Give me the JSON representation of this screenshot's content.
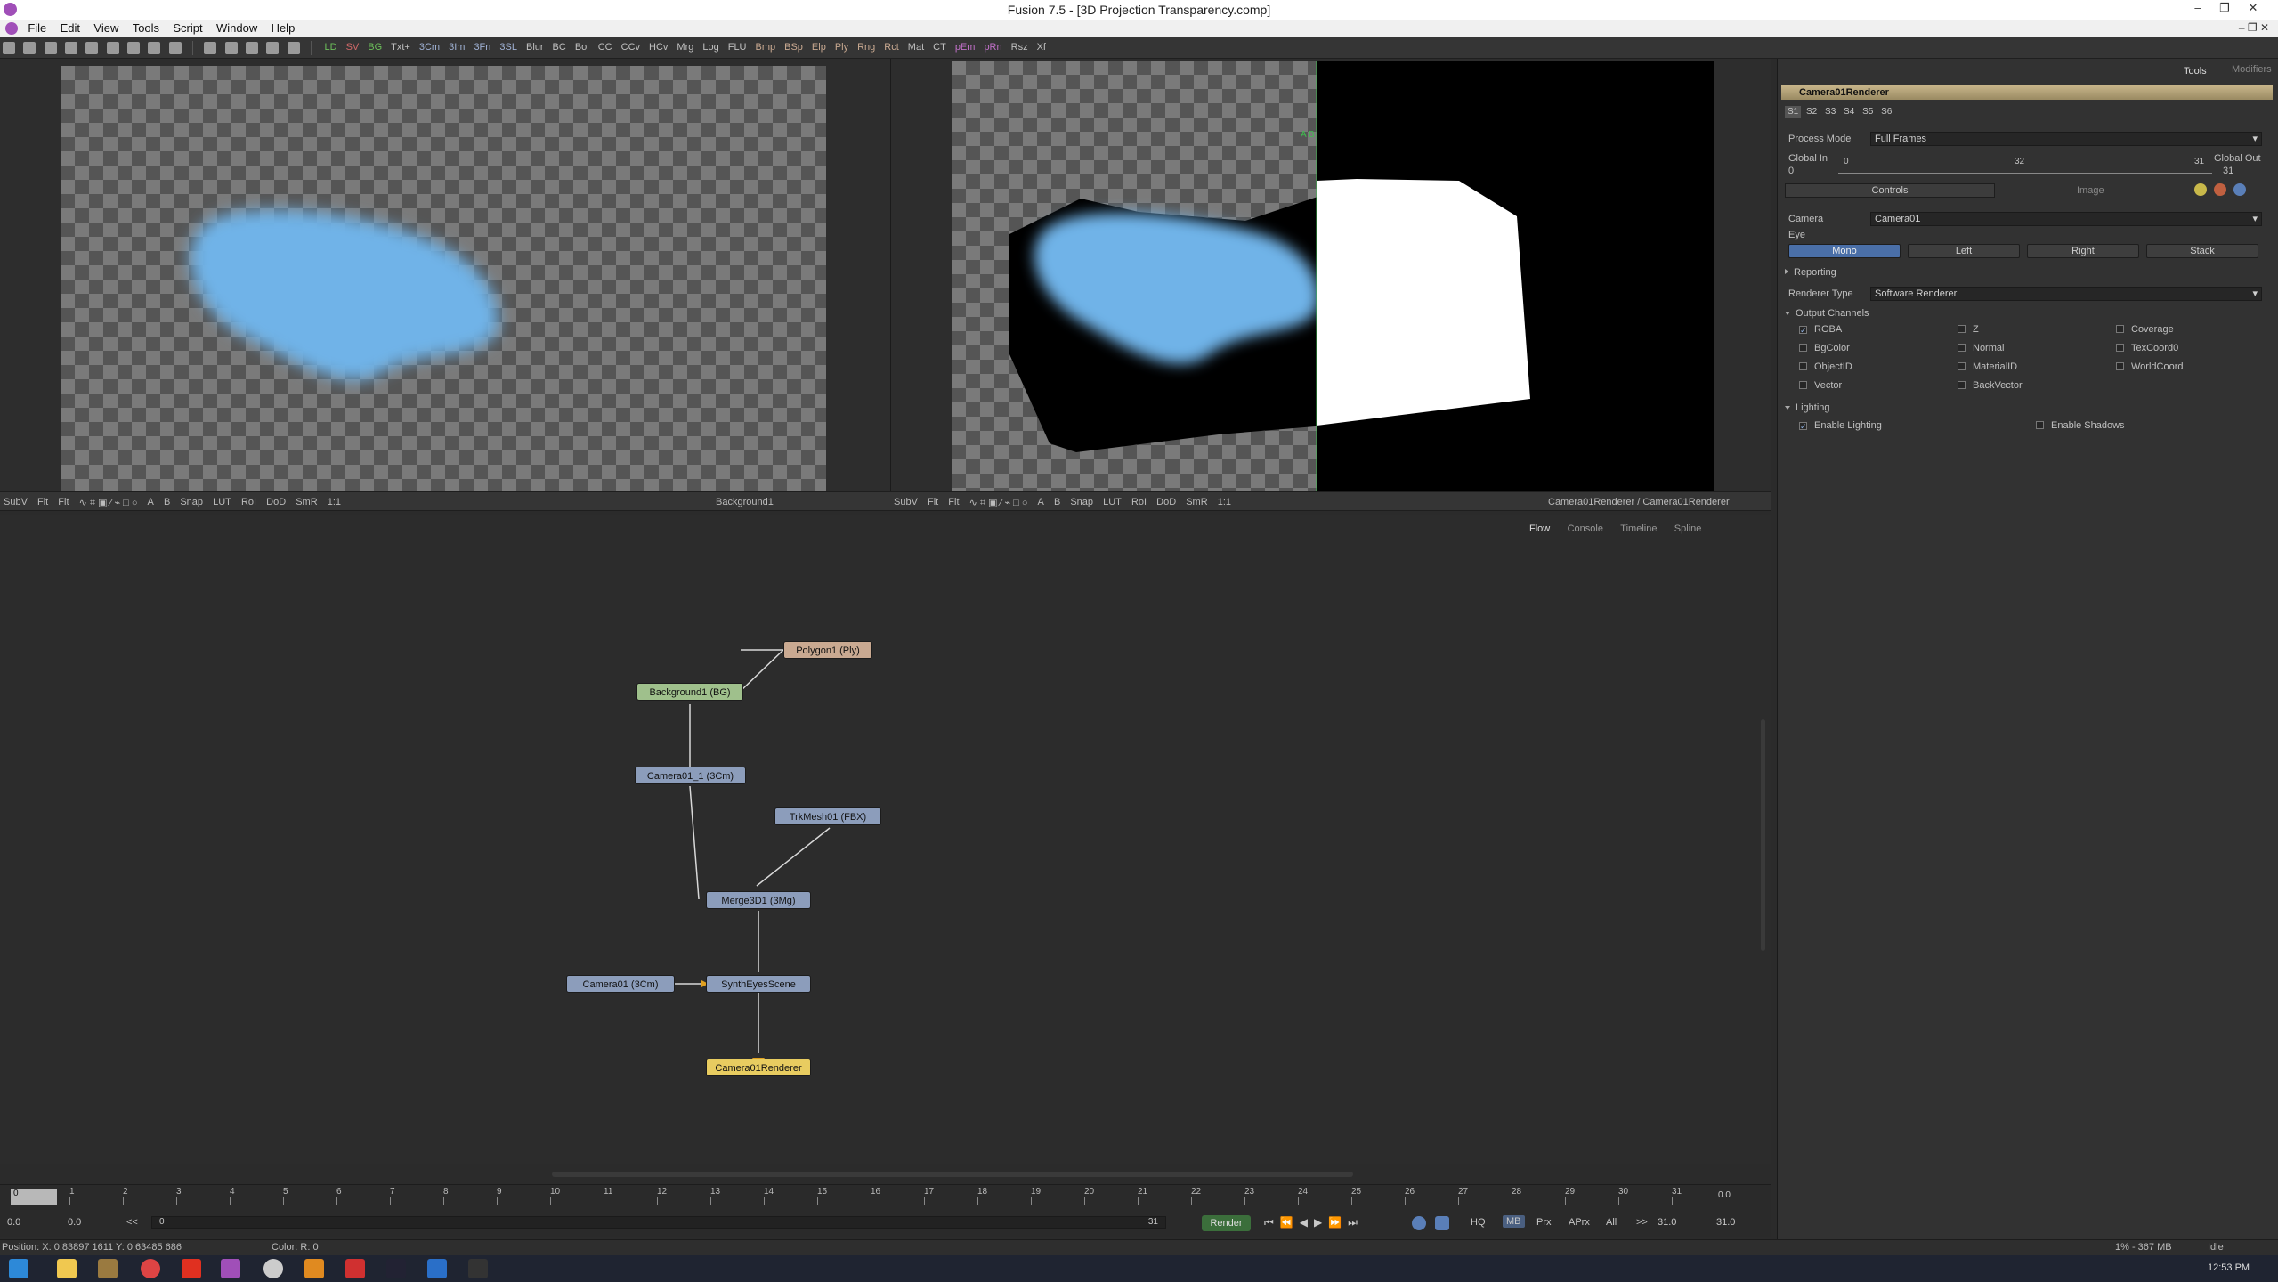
{
  "window": {
    "title": "Fusion 7.5 - [3D Projection Transparency.comp]"
  },
  "menu": [
    "File",
    "Edit",
    "View",
    "Tools",
    "Script",
    "Window",
    "Help"
  ],
  "toolbar": {
    "tools": [
      {
        "label": "LD",
        "color": "#6cbf5a"
      },
      {
        "label": "SV",
        "color": "#d06868"
      },
      {
        "label": "BG",
        "color": "#6cbf5a"
      },
      {
        "label": "Txt+",
        "color": "#c0c0c0"
      },
      {
        "label": "3Cm",
        "color": "#9fb1d4"
      },
      {
        "label": "3Im",
        "color": "#9fb1d4"
      },
      {
        "label": "3Fn",
        "color": "#9fb1d4"
      },
      {
        "label": "3SL",
        "color": "#9fb1d4"
      },
      {
        "label": "Blur",
        "color": "#c0c0c0"
      },
      {
        "label": "BC",
        "color": "#c0c0c0"
      },
      {
        "label": "Bol",
        "color": "#c0c0c0"
      },
      {
        "label": "CC",
        "color": "#c0c0c0"
      },
      {
        "label": "CCv",
        "color": "#c0c0c0"
      },
      {
        "label": "HCv",
        "color": "#c0c0c0"
      },
      {
        "label": "Mrg",
        "color": "#c0c0c0"
      },
      {
        "label": "Log",
        "color": "#c0c0c0"
      },
      {
        "label": "FLU",
        "color": "#c0c0c0"
      },
      {
        "label": "Bmp",
        "color": "#c9a991"
      },
      {
        "label": "BSp",
        "color": "#c9a991"
      },
      {
        "label": "Elp",
        "color": "#c9a991"
      },
      {
        "label": "Ply",
        "color": "#c9a991"
      },
      {
        "label": "Rng",
        "color": "#c9a991"
      },
      {
        "label": "Rct",
        "color": "#c9a991"
      },
      {
        "label": "Mat",
        "color": "#c0c0c0"
      },
      {
        "label": "CT",
        "color": "#c0c0c0"
      },
      {
        "label": "pEm",
        "color": "#c070c8"
      },
      {
        "label": "pRn",
        "color": "#c070c8"
      },
      {
        "label": "Rsz",
        "color": "#c0c0c0"
      },
      {
        "label": "Xf",
        "color": "#c0c0c0"
      }
    ]
  },
  "viewer_left": {
    "bar": [
      "SubV",
      "Fit",
      "Fit",
      "Snap",
      "LUT",
      "RoI",
      "DoD",
      "SmR",
      "1:1"
    ],
    "title": "Background1"
  },
  "viewer_right": {
    "bar": [
      "SubV",
      "Fit",
      "Fit",
      "Snap",
      "LUT",
      "RoI",
      "DoD",
      "SmR",
      "1:1"
    ],
    "title": "Camera01Renderer / Camera01Renderer",
    "ab_label": "A  B"
  },
  "flow": {
    "tabs": [
      "Flow",
      "Console",
      "Timeline",
      "Spline"
    ],
    "nodes": {
      "polygon": "Polygon1 (Ply)",
      "background": "Background1 (BG)",
      "camera1": "Camera01_1 (3Cm)",
      "trkmesh": "TrkMesh01 (FBX)",
      "merge": "Merge3D1 (3Mg)",
      "camera01": "Camera01 (3Cm)",
      "synth": "SynthEyesScene",
      "renderer": "Camera01Renderer"
    }
  },
  "timeline": {
    "ticks": [
      "0",
      "1",
      "2",
      "3",
      "4",
      "5",
      "6",
      "7",
      "8",
      "9",
      "10",
      "11",
      "12",
      "13",
      "14",
      "15",
      "16",
      "17",
      "18",
      "19",
      "20",
      "21",
      "22",
      "23",
      "24",
      "25",
      "26",
      "27",
      "28",
      "29",
      "30",
      "31"
    ],
    "start_field": "0",
    "end_value": "0.0",
    "row2_left": "0.0",
    "row2_left2": "0.0",
    "row2_lt": "<<",
    "row2_current": "0",
    "row2_end": "31",
    "render_label": "Render",
    "hq": "HQ",
    "mb": "MB",
    "prx": "Prx",
    "aprx": "APrx",
    "all": "All",
    "gt": ">>",
    "end_time": "31.0",
    "end_time2": "31.0"
  },
  "status": {
    "position": "Position:  X: 0.83897     1611     Y: 0.63485     686",
    "color": "Color: R: 0",
    "memory": "1% - 367 MB",
    "state": "Idle"
  },
  "inspector": {
    "tabs": [
      "Tools",
      "Modifiers"
    ],
    "tool_name": "Camera01Renderer",
    "slots": [
      "S1",
      "S2",
      "S3",
      "S4",
      "S5",
      "S6"
    ],
    "process_mode_label": "Process Mode",
    "process_mode_value": "Full Frames",
    "global_in_label": "Global In",
    "global_out_label": "Global Out",
    "global_in_value": "0",
    "global_out_value": "31",
    "range_start": "0",
    "range_mid": "32",
    "range_end": "31",
    "subtabs": [
      "Controls",
      "Image"
    ],
    "camera_label": "Camera",
    "camera_value": "Camera01",
    "eye_label": "Eye",
    "eye_options": [
      "Mono",
      "Left",
      "Right",
      "Stack"
    ],
    "reporting": "Reporting",
    "renderer_type_label": "Renderer Type",
    "renderer_type_value": "Software Renderer",
    "output_channels": "Output Channels",
    "channels": [
      {
        "label": "RGBA",
        "checked": true
      },
      {
        "label": "Z",
        "checked": false
      },
      {
        "label": "Coverage",
        "checked": false
      },
      {
        "label": "BgColor",
        "checked": false
      },
      {
        "label": "Normal",
        "checked": false
      },
      {
        "label": "TexCoord0",
        "checked": false
      },
      {
        "label": "ObjectID",
        "checked": false
      },
      {
        "label": "MaterialID",
        "checked": false
      },
      {
        "label": "WorldCoord",
        "checked": false
      },
      {
        "label": "Vector",
        "checked": false
      },
      {
        "label": "BackVector",
        "checked": false
      }
    ],
    "lighting": "Lighting",
    "enable_lighting": "Enable Lighting",
    "enable_shadows": "Enable Shadows"
  },
  "taskbar": {
    "time": "12:53 PM"
  },
  "colors": {
    "renderer_node": "#e8cc60",
    "camera_node": "#8c9dbb",
    "bg_node": "#9fc08c",
    "poly_node": "#c9a991",
    "blob": "#6fb3e8",
    "active_eye": "#4a6fa8"
  }
}
